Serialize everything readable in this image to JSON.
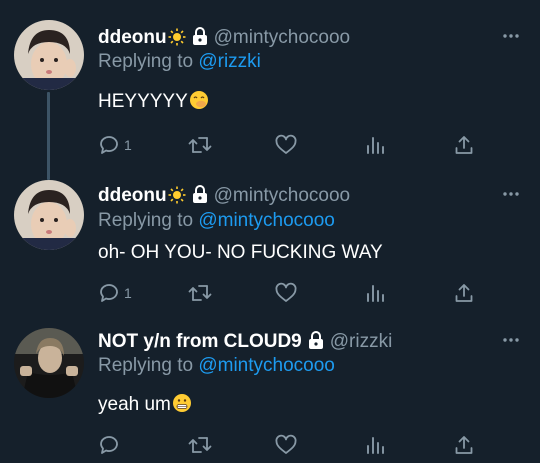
{
  "thread": [
    {
      "display_name": "ddeonu",
      "handle": "@mintychocooo",
      "replying_prefix": "Replying to",
      "replying_to": "@rizzki",
      "text": "HEYYYYY",
      "text_emoji": "face-with-hand-over-mouth-icon",
      "name_emoji": "sun-icon",
      "reply_count": "1",
      "retweet_count": "",
      "like_count": ""
    },
    {
      "display_name": "ddeonu",
      "handle": "@mintychocooo",
      "replying_prefix": "Replying to",
      "replying_to": "@mintychocooo",
      "text": "oh- OH YOU- NO FUCKING WAY",
      "name_emoji": "sun-icon",
      "reply_count": "1",
      "retweet_count": "",
      "like_count": ""
    },
    {
      "display_name": "NOT y/n from CLOUD9",
      "handle": "@rizzki",
      "replying_prefix": "Replying to",
      "replying_to": "@mintychocooo",
      "text": "yeah um",
      "text_emoji": "grimacing-face-icon",
      "reply_count": "",
      "retweet_count": "",
      "like_count": ""
    }
  ],
  "colors": {
    "background": "#15202b",
    "secondary_text": "#8899a6",
    "link": "#1d9bf0",
    "thread_line": "#3d5466"
  }
}
